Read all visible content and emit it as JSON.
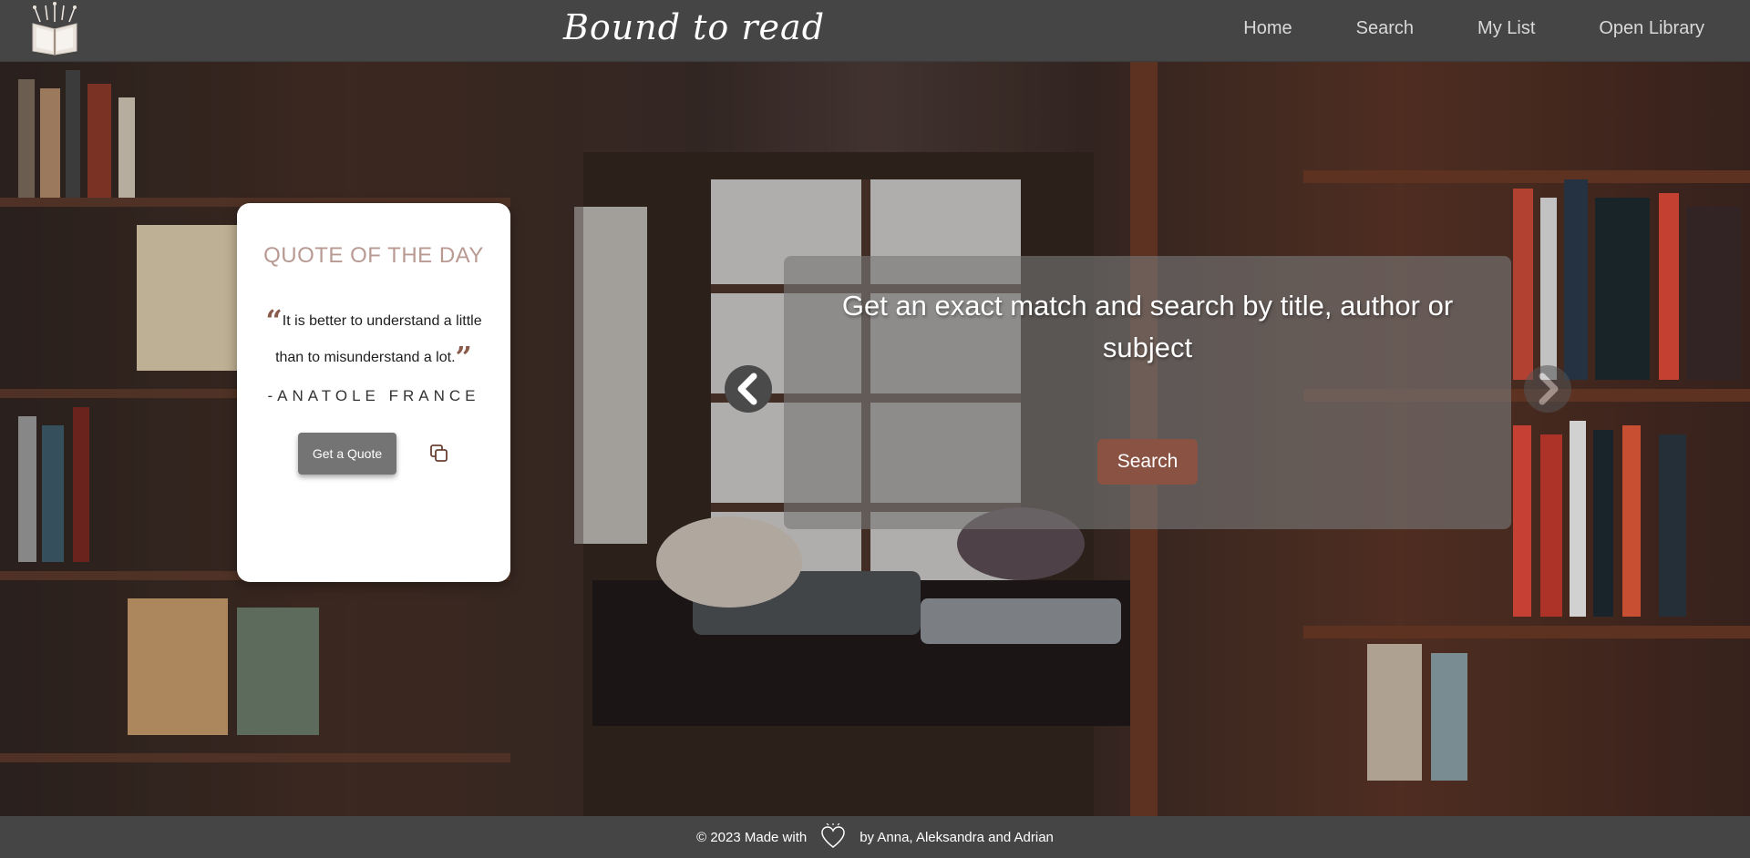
{
  "header": {
    "title": "Bound to read",
    "nav": [
      {
        "label": "Home"
      },
      {
        "label": "Search"
      },
      {
        "label": "My List"
      },
      {
        "label": "Open Library"
      }
    ]
  },
  "quote": {
    "heading": "QUOTE OF THE DAY",
    "text": "It is better to understand a little than to misunderstand a lot.",
    "author": "-ANATOLE FRANCE",
    "button_label": "Get a Quote"
  },
  "search_panel": {
    "text": "Get an exact match and search by title, author or subject",
    "button_label": "Search"
  },
  "footer": {
    "left_text": "© 2023 Made with",
    "right_text": "by Anna, Aleksandra and Adrian"
  },
  "colors": {
    "header_bg": "#464545",
    "accent": "#8a5243",
    "quote_heading": "#b89a93"
  },
  "icons": [
    "book-logo-icon",
    "copy-icon",
    "chevron-left-icon",
    "chevron-right-icon",
    "heart-icon"
  ]
}
